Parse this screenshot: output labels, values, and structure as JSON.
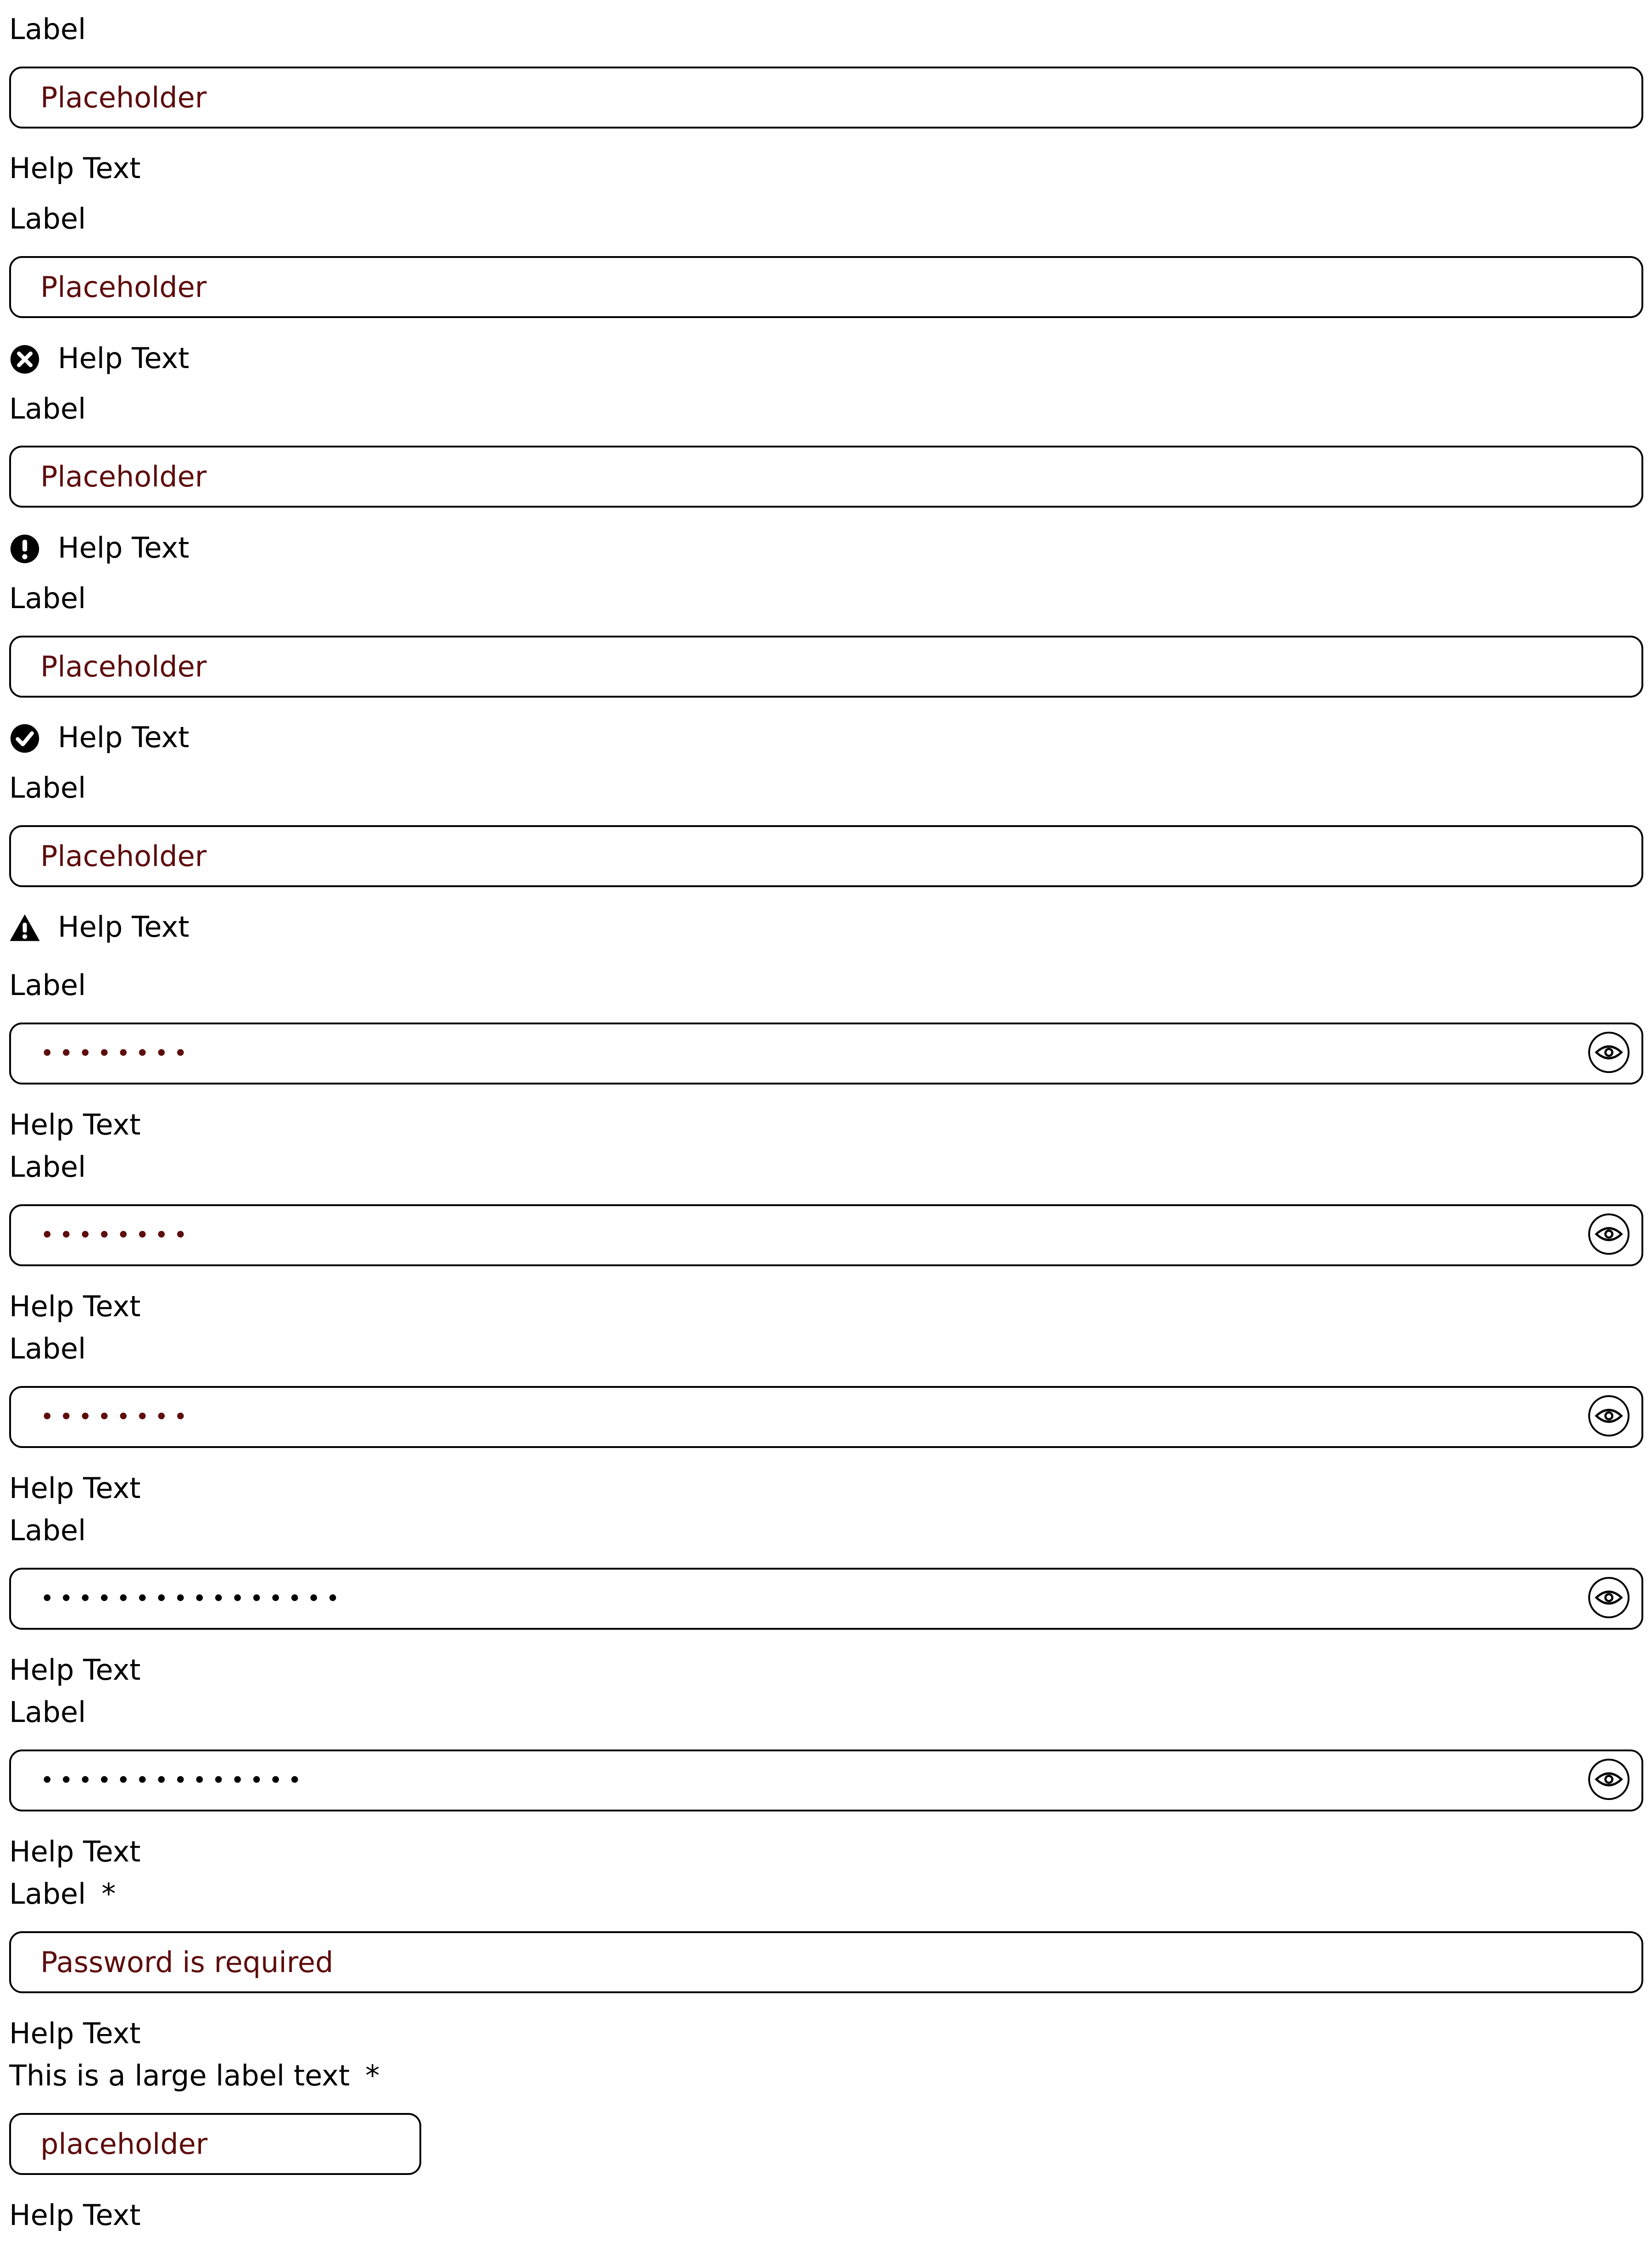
{
  "fields": [
    {
      "label": "Label",
      "value": "Placeholder",
      "help": "Help Text",
      "help_icon": ""
    },
    {
      "label": "Label",
      "value": "Placeholder",
      "help": "Help Text",
      "help_icon": "error-circle-x-icon"
    },
    {
      "label": "Label",
      "value": "Placeholder",
      "help": "Help Text",
      "help_icon": "alert-circle-exclamation-icon"
    },
    {
      "label": "Label",
      "value": "Placeholder",
      "help": "Help Text",
      "help_icon": "success-circle-check-icon"
    },
    {
      "label": "Label",
      "value": "Placeholder",
      "help": "Help Text",
      "help_icon": "warning-triangle-icon"
    },
    {
      "label": "Label",
      "value": "••••••••",
      "help": "Help Text",
      "reveal_icon": "eye-icon"
    },
    {
      "label": "Label",
      "value": "••••••••",
      "help": "Help Text",
      "reveal_icon": "eye-icon"
    },
    {
      "label": "Label",
      "value": "••••••••",
      "help": "Help Text",
      "reveal_icon": "eye-icon"
    },
    {
      "label": "Label",
      "value": "••••••••••••••••",
      "help": "Help Text",
      "reveal_icon": "eye-icon"
    },
    {
      "label": "Label",
      "value": "••••••••••••••",
      "help": "Help Text",
      "reveal_icon": "eye-icon"
    },
    {
      "label": "Label",
      "required_mark": "*",
      "value": "Password is required",
      "help": "Help Text"
    },
    {
      "label": "This is a large label text",
      "required_mark": "*",
      "value": "placeholder",
      "help": "Help Text"
    }
  ],
  "colors": {
    "placeholder_text": "#5e0d0d",
    "border": "#000000",
    "text": "#000000"
  }
}
